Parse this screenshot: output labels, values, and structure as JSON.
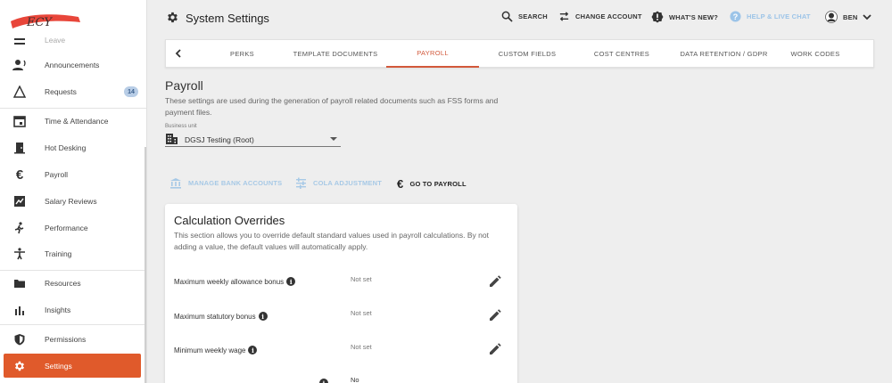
{
  "sidebar": {
    "logo_text": "ECY",
    "items": [
      {
        "label": "Leave",
        "icon": "menu-icon"
      },
      {
        "label": "Announcements",
        "icon": "people-icon"
      },
      {
        "label": "Requests",
        "icon": "triangle-icon",
        "badge": "14"
      },
      {
        "label": "Time & Attendance",
        "icon": "calendar-icon"
      },
      {
        "label": "Hot Desking",
        "icon": "door-icon"
      },
      {
        "label": "Payroll",
        "icon": "euro-icon"
      },
      {
        "label": "Salary Reviews",
        "icon": "salary-icon"
      },
      {
        "label": "Performance",
        "icon": "run-icon"
      },
      {
        "label": "Training",
        "icon": "person-icon"
      },
      {
        "label": "Resources",
        "icon": "folder-icon"
      },
      {
        "label": "Insights",
        "icon": "bar-chart-icon"
      },
      {
        "label": "Permissions",
        "icon": "shield-icon"
      },
      {
        "label": "Settings",
        "icon": "gear-icon",
        "active": true
      }
    ]
  },
  "header": {
    "title": "System Settings",
    "search": "SEARCH",
    "change_account": "CHANGE ACCOUNT",
    "whats_new": "WHAT'S NEW?",
    "help": "HELP & LIVE CHAT",
    "user": "BEN"
  },
  "tabs": [
    "PERKS",
    "TEMPLATE DOCUMENTS",
    "PAYROLL",
    "CUSTOM FIELDS",
    "COST CENTRES",
    "DATA RETENTION / GDPR",
    "WORK CODES"
  ],
  "active_tab": "PAYROLL",
  "payroll": {
    "title": "Payroll",
    "description": "These settings are used during the generation of payroll related documents such as FSS forms and payment files.",
    "business_unit_label": "Business unit",
    "business_unit_value": "DGSJ Testing (Root)",
    "manage_bank": "MANAGE BANK ACCOUNTS",
    "cola": "COLA ADJUSTMENT",
    "go_to_payroll": "GO TO PAYROLL"
  },
  "card": {
    "title": "Calculation Overrides",
    "description": "This section allows you to override default standard values used in payroll calculations. By not adding a value, the default values will automatically apply.",
    "rows": [
      {
        "label": "Maximum weekly allowance bonus",
        "value": "Not set"
      },
      {
        "label": "Maximum statutory bonus",
        "value": "Not set"
      },
      {
        "label": "Minimum weekly wage",
        "value": "Not set"
      },
      {
        "label": "",
        "value": "No"
      }
    ]
  },
  "colors": {
    "accent": "#e05a2b",
    "tab_active": "#d2583a",
    "muted_blue": "#a7c9e6",
    "badge_bg": "#b8cde6"
  }
}
